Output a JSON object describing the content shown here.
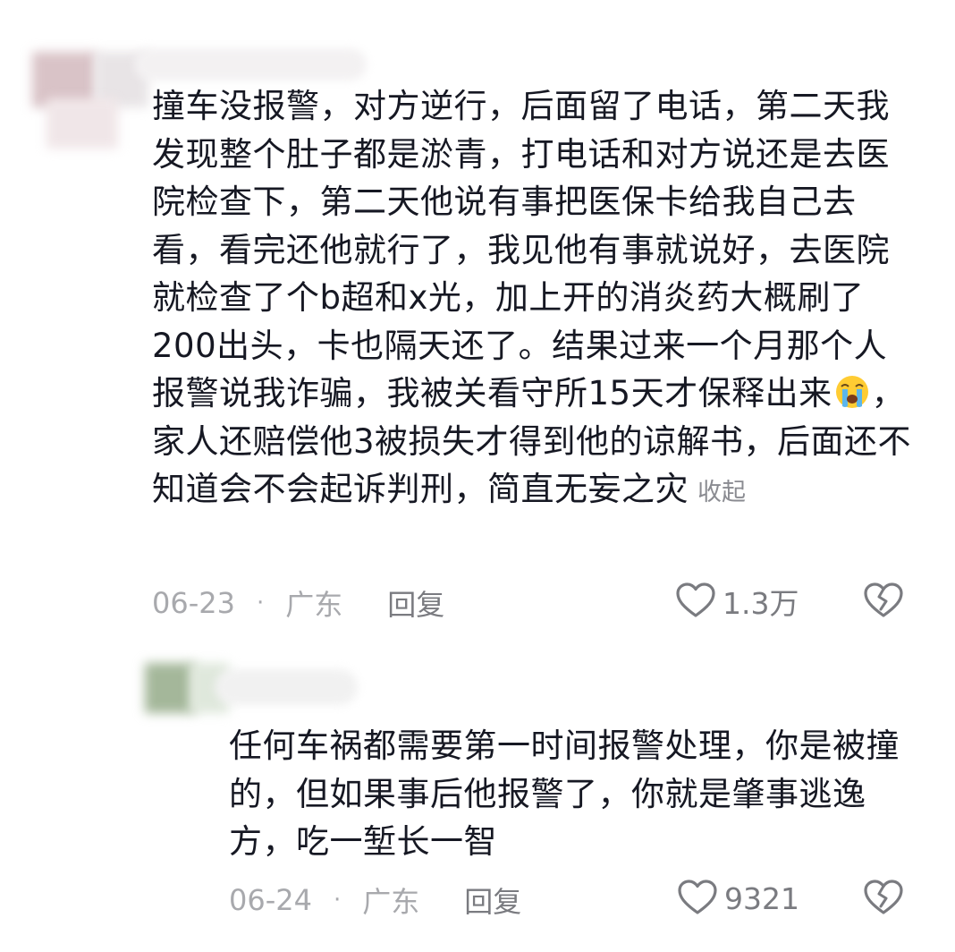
{
  "comments": [
    {
      "text_before_emoji": "撞车没报警，对方逆行，后面留了电话，第二天我发现整个肚子都是淤青，打电话和对方说还是去医院检查下，第二天他说有事把医保卡给我自己去看，看完还他就行了，我见他有事就说好，去医院就检查了个b超和x光，加上开的消炎药大概刷了200出头，卡也隔天还了。结果过来一个月那个人报警说我诈骗，我被关看守所15天才保释出来",
      "emoji": "loudly-crying-face-emoji",
      "text_after_emoji": "，家人还赔偿他3被损失才得到他的谅解书，后面还不知道会不会起诉判刑，简直无妄之灾",
      "collapse_label": "收起",
      "date": "06-23",
      "separator": "·",
      "location": "广东",
      "reply_label": "回复",
      "like_count": "1.3万",
      "like_icon": "heart-outline-icon",
      "dislike_icon": "broken-heart-icon"
    },
    {
      "text": "任何车祸都需要第一时间报警处理，你是被撞的，但如果事后他报警了，你就是肇事逃逸方，吃一堑长一智",
      "date": "06-24",
      "separator": "·",
      "location": "广东",
      "reply_label": "回复",
      "like_count": "9321",
      "like_icon": "heart-outline-icon",
      "dislike_icon": "broken-heart-icon"
    }
  ],
  "colors": {
    "text": "#161823",
    "meta": "#a8a9ad",
    "reply": "#7a7b80",
    "collapse": "#8a8b91"
  }
}
